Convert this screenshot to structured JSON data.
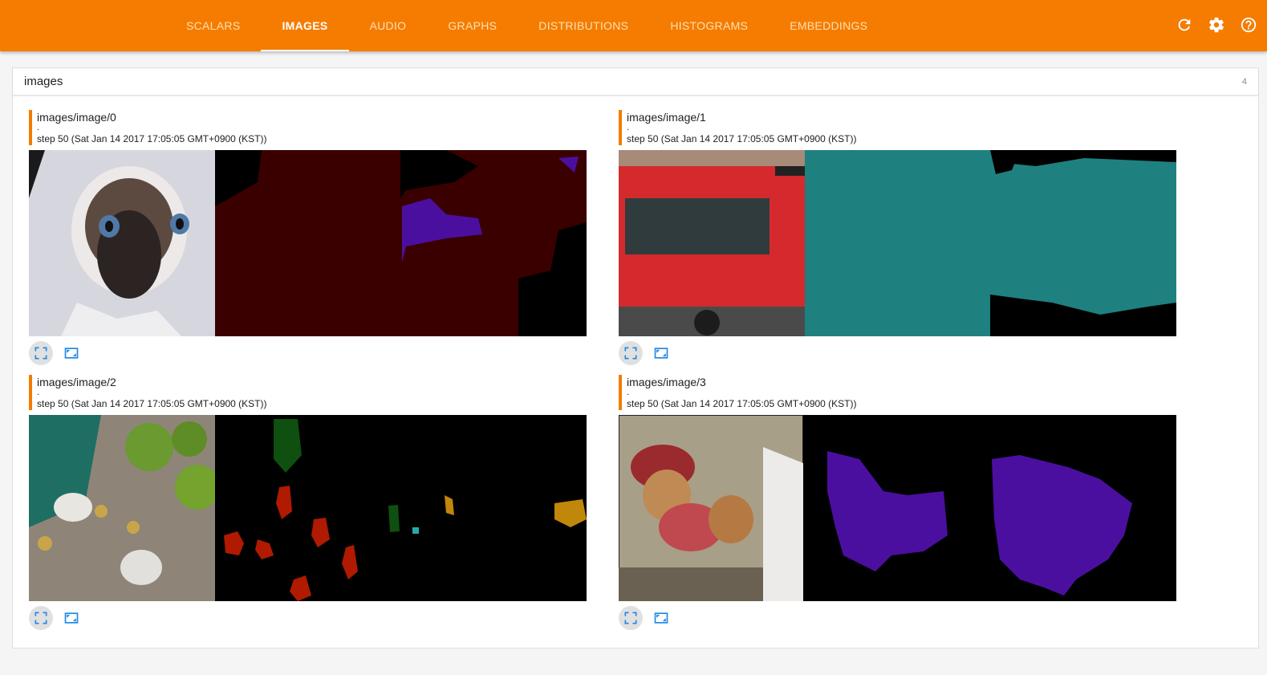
{
  "header": {
    "tabs": [
      {
        "label": "SCALARS",
        "active": false
      },
      {
        "label": "IMAGES",
        "active": true
      },
      {
        "label": "AUDIO",
        "active": false
      },
      {
        "label": "GRAPHS",
        "active": false
      },
      {
        "label": "DISTRIBUTIONS",
        "active": false
      },
      {
        "label": "HISTOGRAMS",
        "active": false
      },
      {
        "label": "EMBEDDINGS",
        "active": false
      }
    ],
    "icons": [
      "refresh-icon",
      "settings-icon",
      "help-icon"
    ]
  },
  "category": {
    "title": "images",
    "count": "4"
  },
  "cards": [
    {
      "tag": "images/image/0",
      "dot": ".",
      "step": "step 50 (Sat Jan 14 2017 17:05:05 GMT+0900 (KST))"
    },
    {
      "tag": "images/image/1",
      "dot": ".",
      "step": "step 50 (Sat Jan 14 2017 17:05:05 GMT+0900 (KST))"
    },
    {
      "tag": "images/image/2",
      "dot": ".",
      "step": "step 50 (Sat Jan 14 2017 17:05:05 GMT+0900 (KST))"
    },
    {
      "tag": "images/image/3",
      "dot": ".",
      "step": "step 50 (Sat Jan 14 2017 17:05:05 GMT+0900 (KST))"
    }
  ],
  "colors": {
    "accent": "#f57c00",
    "control_blue": "#1e88e5",
    "seg_maroon": "#3a0000",
    "seg_teal": "#1f8080",
    "seg_purple": "#4b0fa0"
  }
}
